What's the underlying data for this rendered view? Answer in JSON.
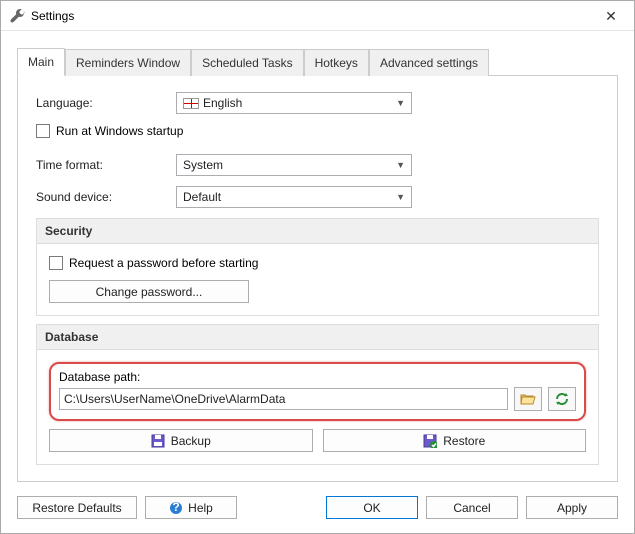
{
  "window": {
    "title": "Settings"
  },
  "tabs": [
    "Main",
    "Reminders Window",
    "Scheduled Tasks",
    "Hotkeys",
    "Advanced settings"
  ],
  "main": {
    "language_label": "Language:",
    "language_value": "English",
    "run_startup": "Run at Windows startup",
    "time_format_label": "Time format:",
    "time_format_value": "System",
    "sound_device_label": "Sound device:",
    "sound_device_value": "Default"
  },
  "security": {
    "title": "Security",
    "request_password": "Request a password before starting",
    "change_password": "Change password..."
  },
  "database": {
    "title": "Database",
    "path_label": "Database path:",
    "path_value": "C:\\Users\\UserName\\OneDrive\\AlarmData",
    "backup": "Backup",
    "restore": "Restore"
  },
  "buttons": {
    "restore_defaults": "Restore Defaults",
    "help": "Help",
    "ok": "OK",
    "cancel": "Cancel",
    "apply": "Apply"
  }
}
